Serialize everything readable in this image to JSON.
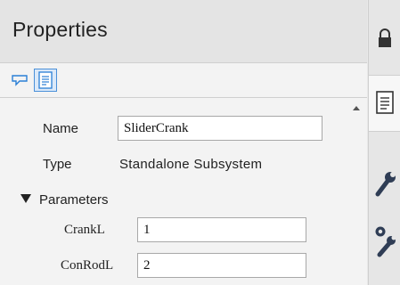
{
  "panel": {
    "title": "Properties"
  },
  "toolbar": {
    "icons": [
      "comment-icon",
      "document-icon"
    ]
  },
  "properties": {
    "name_label": "Name",
    "name_value": "SliderCrank",
    "type_label": "Type",
    "type_value": "Standalone Subsystem"
  },
  "parameters": {
    "section_label": "Parameters",
    "items": [
      {
        "label": "CrankL",
        "value": "1"
      },
      {
        "label": "ConRodL",
        "value": "2"
      }
    ]
  },
  "side_tabs": [
    "lock-icon",
    "document-icon",
    "wrench-icon",
    "wrench-gear-icon"
  ]
}
